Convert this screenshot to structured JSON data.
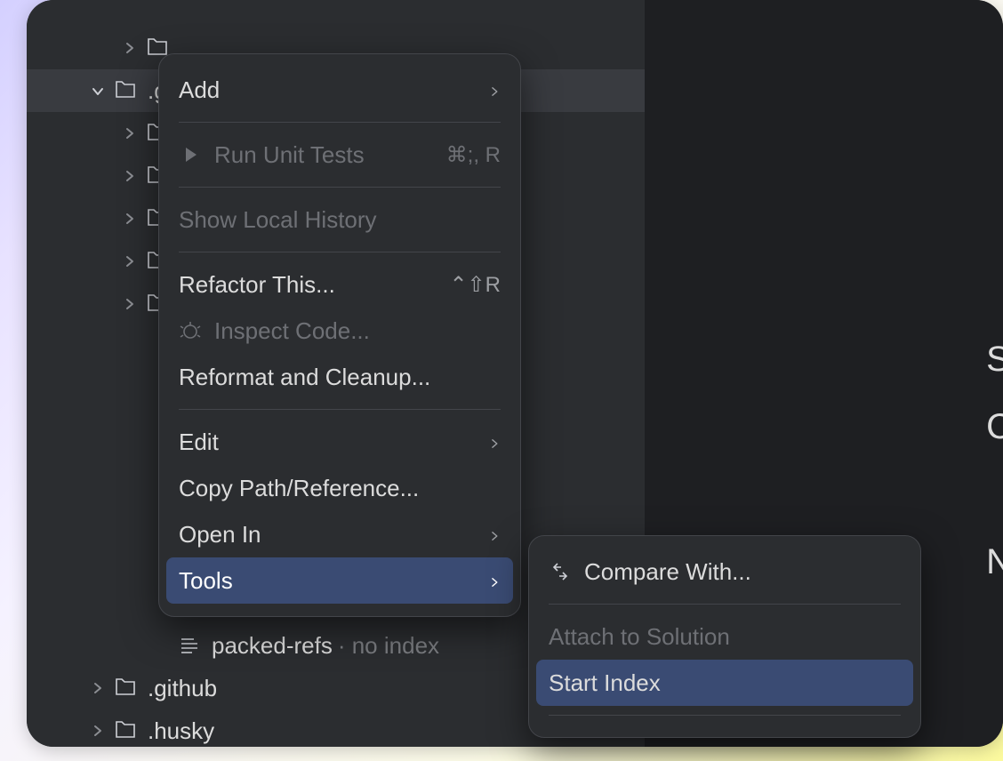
{
  "tree": {
    "selected": {
      "name": ".git"
    },
    "children": [
      {
        "indent": "indent-2",
        "type": "folder",
        "chev": "right"
      },
      {
        "indent": "indent-2",
        "type": "folder",
        "chev": "right"
      },
      {
        "indent": "indent-2",
        "type": "folder",
        "chev": "right"
      },
      {
        "indent": "indent-2",
        "type": "folder",
        "chev": "right"
      },
      {
        "indent": "indent-2",
        "type": "folder",
        "chev": "right"
      }
    ],
    "files": [
      {
        "indent": "indent-3",
        "type": "file"
      },
      {
        "indent": "indent-3",
        "type": "file"
      },
      {
        "indent": "indent-3",
        "type": "file"
      },
      {
        "indent": "indent-3",
        "type": "file"
      },
      {
        "indent": "indent-3",
        "type": "file"
      },
      {
        "indent": "indent-3",
        "type": "question"
      },
      {
        "indent": "indent-3",
        "type": "file"
      }
    ],
    "packed_refs": {
      "name": "packed-refs",
      "suffix": "· no index"
    },
    "below": [
      {
        "name": ".github"
      },
      {
        "name": ".husky"
      }
    ]
  },
  "ctx": {
    "add": "Add",
    "run_tests": "Run Unit Tests",
    "run_tests_sc": "⌘;, R",
    "show_history": "Show Local History",
    "refactor": "Refactor This...",
    "refactor_sc": "⌃⇧R",
    "inspect": "Inspect Code...",
    "reformat": "Reformat and Cleanup...",
    "edit": "Edit",
    "copy_path": "Copy Path/Reference...",
    "open_in": "Open In",
    "tools": "Tools"
  },
  "sub": {
    "compare": "Compare With...",
    "attach": "Attach to Solution",
    "start_index": "Start Index"
  },
  "editor_hint_letters": [
    "S",
    "C",
    "",
    "N",
    ""
  ]
}
